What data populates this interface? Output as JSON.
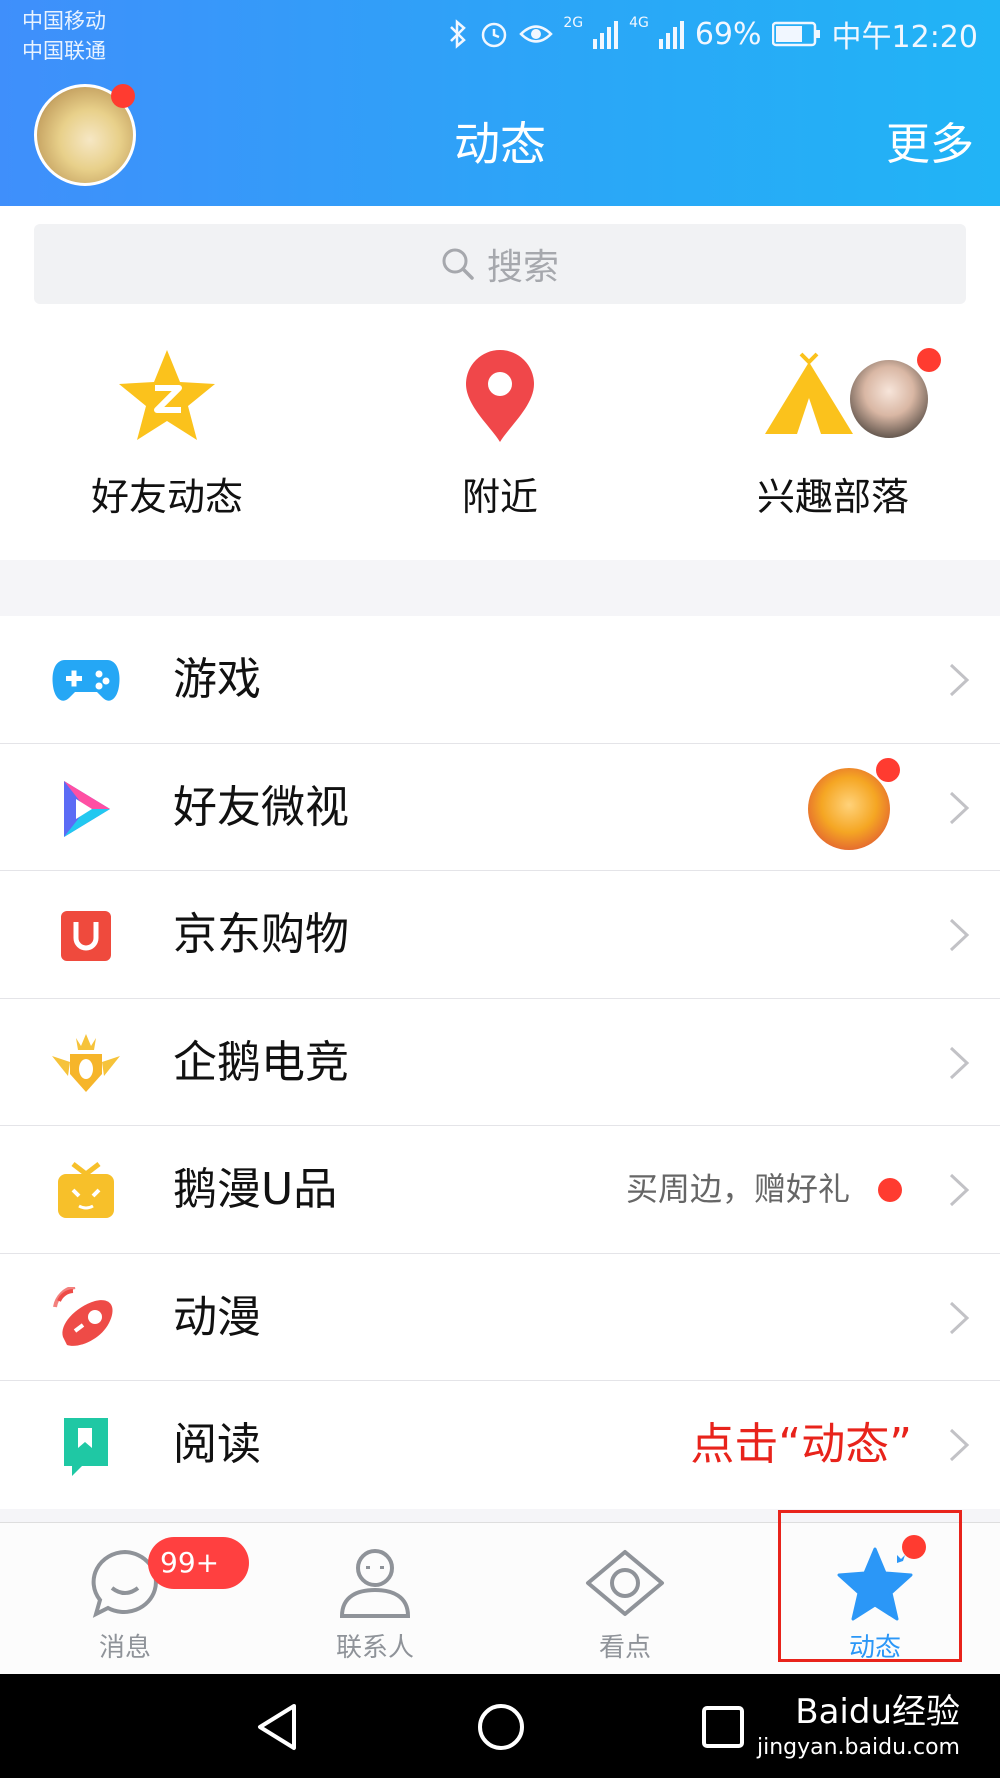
{
  "status_bar": {
    "carrier_1": "中国移动",
    "carrier_2": "中国联通",
    "signal_1": "2G",
    "signal_2": "4G",
    "battery": "69%",
    "time": "中午12:20"
  },
  "header": {
    "title": "动态",
    "more_label": "更多"
  },
  "search": {
    "placeholder": "搜索"
  },
  "quick_entries": [
    {
      "label": "好友动态",
      "icon": "qzone-star-icon"
    },
    {
      "label": "附近",
      "icon": "location-pin-icon"
    },
    {
      "label": "兴趣部落",
      "icon": "tent-icon"
    }
  ],
  "list": [
    {
      "label": "游戏",
      "icon": "gamepad-icon"
    },
    {
      "label": "好友微视",
      "icon": "weishi-play-icon"
    },
    {
      "label": "京东购物",
      "icon": "jd-shopping-icon"
    },
    {
      "label": "企鹅电竞",
      "icon": "esports-crest-icon"
    },
    {
      "label": "鹅漫U品",
      "icon": "tv-box-icon",
      "subtitle": "买周边，赠好礼"
    },
    {
      "label": "动漫",
      "icon": "comic-icon"
    },
    {
      "label": "阅读",
      "icon": "bookmark-read-icon"
    }
  ],
  "annotation": "点击“动态”",
  "tabs": [
    {
      "label": "消息",
      "icon": "chat-bubble-icon",
      "badge": "99+"
    },
    {
      "label": "联系人",
      "icon": "contacts-icon"
    },
    {
      "label": "看点",
      "icon": "eye-icon"
    },
    {
      "label": "动态",
      "icon": "star-icon",
      "active": true
    }
  ],
  "watermark": {
    "text": "Baidu经验",
    "sub": "jingyan.baidu.com"
  },
  "colors": {
    "header_start": "#3f8ffb",
    "header_end": "#21b4f6",
    "accent": "#2b97f7",
    "badge_red": "#ff3b30",
    "annotation_red": "#e8231b"
  }
}
